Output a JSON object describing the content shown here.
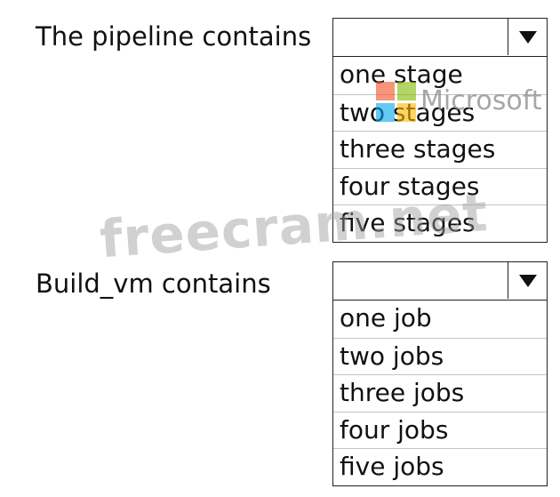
{
  "questions": [
    {
      "label": "The pipeline contains",
      "selected": "",
      "options": [
        "one stage",
        "two stages",
        "three stages",
        "four stages",
        "five stages"
      ]
    },
    {
      "label": "Build_vm contains",
      "selected": "",
      "options": [
        "one job",
        "two jobs",
        "three jobs",
        "four jobs",
        "five jobs"
      ]
    }
  ],
  "watermarks": {
    "brand": "Microsoft",
    "site": "freecram.net"
  },
  "colors": {
    "ms_red": "#f25022",
    "ms_green": "#7fba00",
    "ms_blue": "#00a4ef",
    "ms_yellow": "#ffb900"
  }
}
